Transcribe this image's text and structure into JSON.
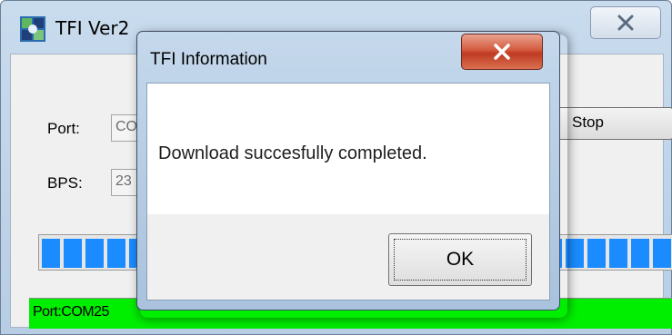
{
  "main_window": {
    "title": "TFI Ver2",
    "port_label": "Port:",
    "port_value": "CO",
    "bps_label": "BPS:",
    "bps_value": "23",
    "stop_label": "Stop",
    "progress_percent": 100,
    "status_text": "Port:COM25",
    "colors": {
      "progress_block": "#1a8cff",
      "status_bar": "#00ee00"
    }
  },
  "dialog": {
    "title": "TFI Information",
    "message": "Download succesfully completed.",
    "ok_label": "OK",
    "close_icon": "close-x-icon"
  }
}
